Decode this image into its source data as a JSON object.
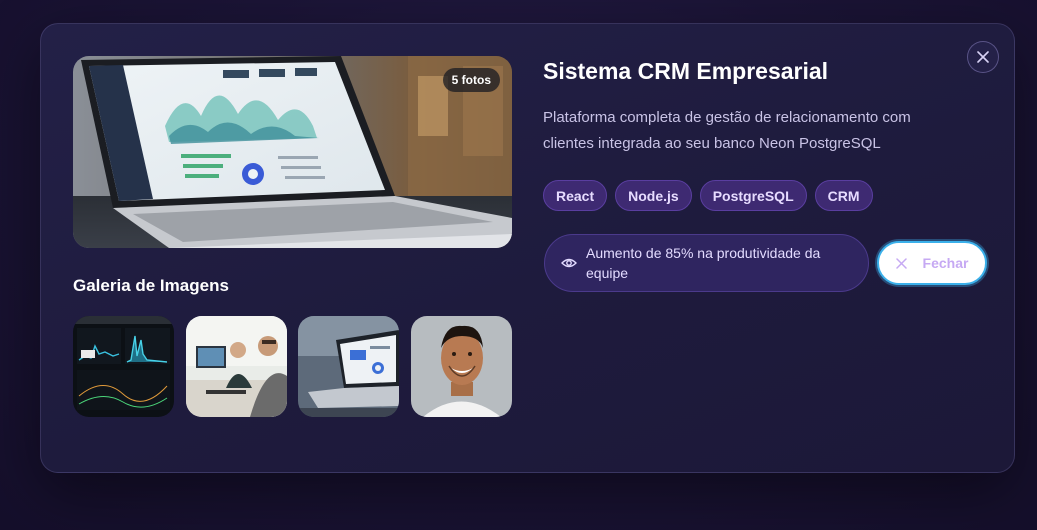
{
  "modal": {
    "title": "Sistema CRM Empresarial",
    "description": "Plataforma completa de gestão de relacionamento com clientes integrada ao seu banco Neon PostgreSQL",
    "photo_count_badge": "5 fotos",
    "gallery_title": "Galeria de Imagens",
    "tags": [
      "React",
      "Node.js",
      "PostgreSQL",
      "CRM"
    ],
    "metric": "Aumento de 85% na produtividade da equipe",
    "close_button_label": "Fechar",
    "icons": {
      "close": "close-icon",
      "metric": "eye-icon",
      "close_button": "x-icon"
    },
    "colors": {
      "accent": "#3bb0ea",
      "tag_bg": "#3e2a72",
      "panel_bg": "#1e1b3d"
    }
  }
}
